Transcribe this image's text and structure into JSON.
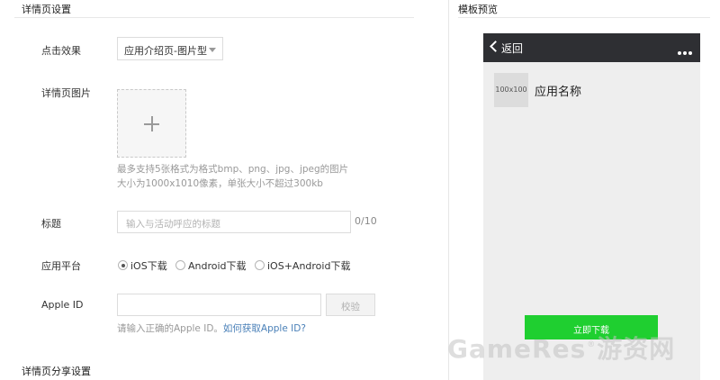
{
  "left_panel": {
    "section_title": "详情页设置",
    "share_section_title": "详情页分享设置",
    "click_effect": {
      "label": "点击效果",
      "value": "应用介绍页-图片型"
    },
    "detail_image": {
      "label": "详情页图片",
      "hint_line1": "最多支持5张格式为格式bmp、png、jpg、jpeg的图片",
      "hint_line2": "大小为1000x1010像素，单张大小不超过300kb"
    },
    "title_field": {
      "label": "标题",
      "placeholder": "输入与活动呼应的标题",
      "counter": "0/10"
    },
    "platform": {
      "label": "应用平台",
      "options": [
        {
          "label": "iOS下载",
          "selected": true
        },
        {
          "label": "Android下载",
          "selected": false
        },
        {
          "label": "iOS+Android下载",
          "selected": false
        }
      ]
    },
    "apple_id": {
      "label": "Apple ID",
      "value": "",
      "verify_label": "校验",
      "hint": "请输入正确的Apple ID。",
      "help_link": "如何获取Apple ID?"
    }
  },
  "right_panel": {
    "section_title": "模板预览",
    "phone": {
      "back_label": "返回",
      "app_icon_text": "100x100",
      "app_name": "应用名称",
      "download_label": "立即下载"
    }
  },
  "watermark": {
    "text": "GameRes",
    "reg": "®",
    "cn": "游资网"
  },
  "colors": {
    "accent_green": "#1fcf30",
    "phone_bar": "#2e2f33",
    "link_blue": "#4a80b8"
  },
  "icons": [
    "plus-icon",
    "caret-down-icon",
    "back-chevron-icon",
    "more-dots-icon"
  ]
}
